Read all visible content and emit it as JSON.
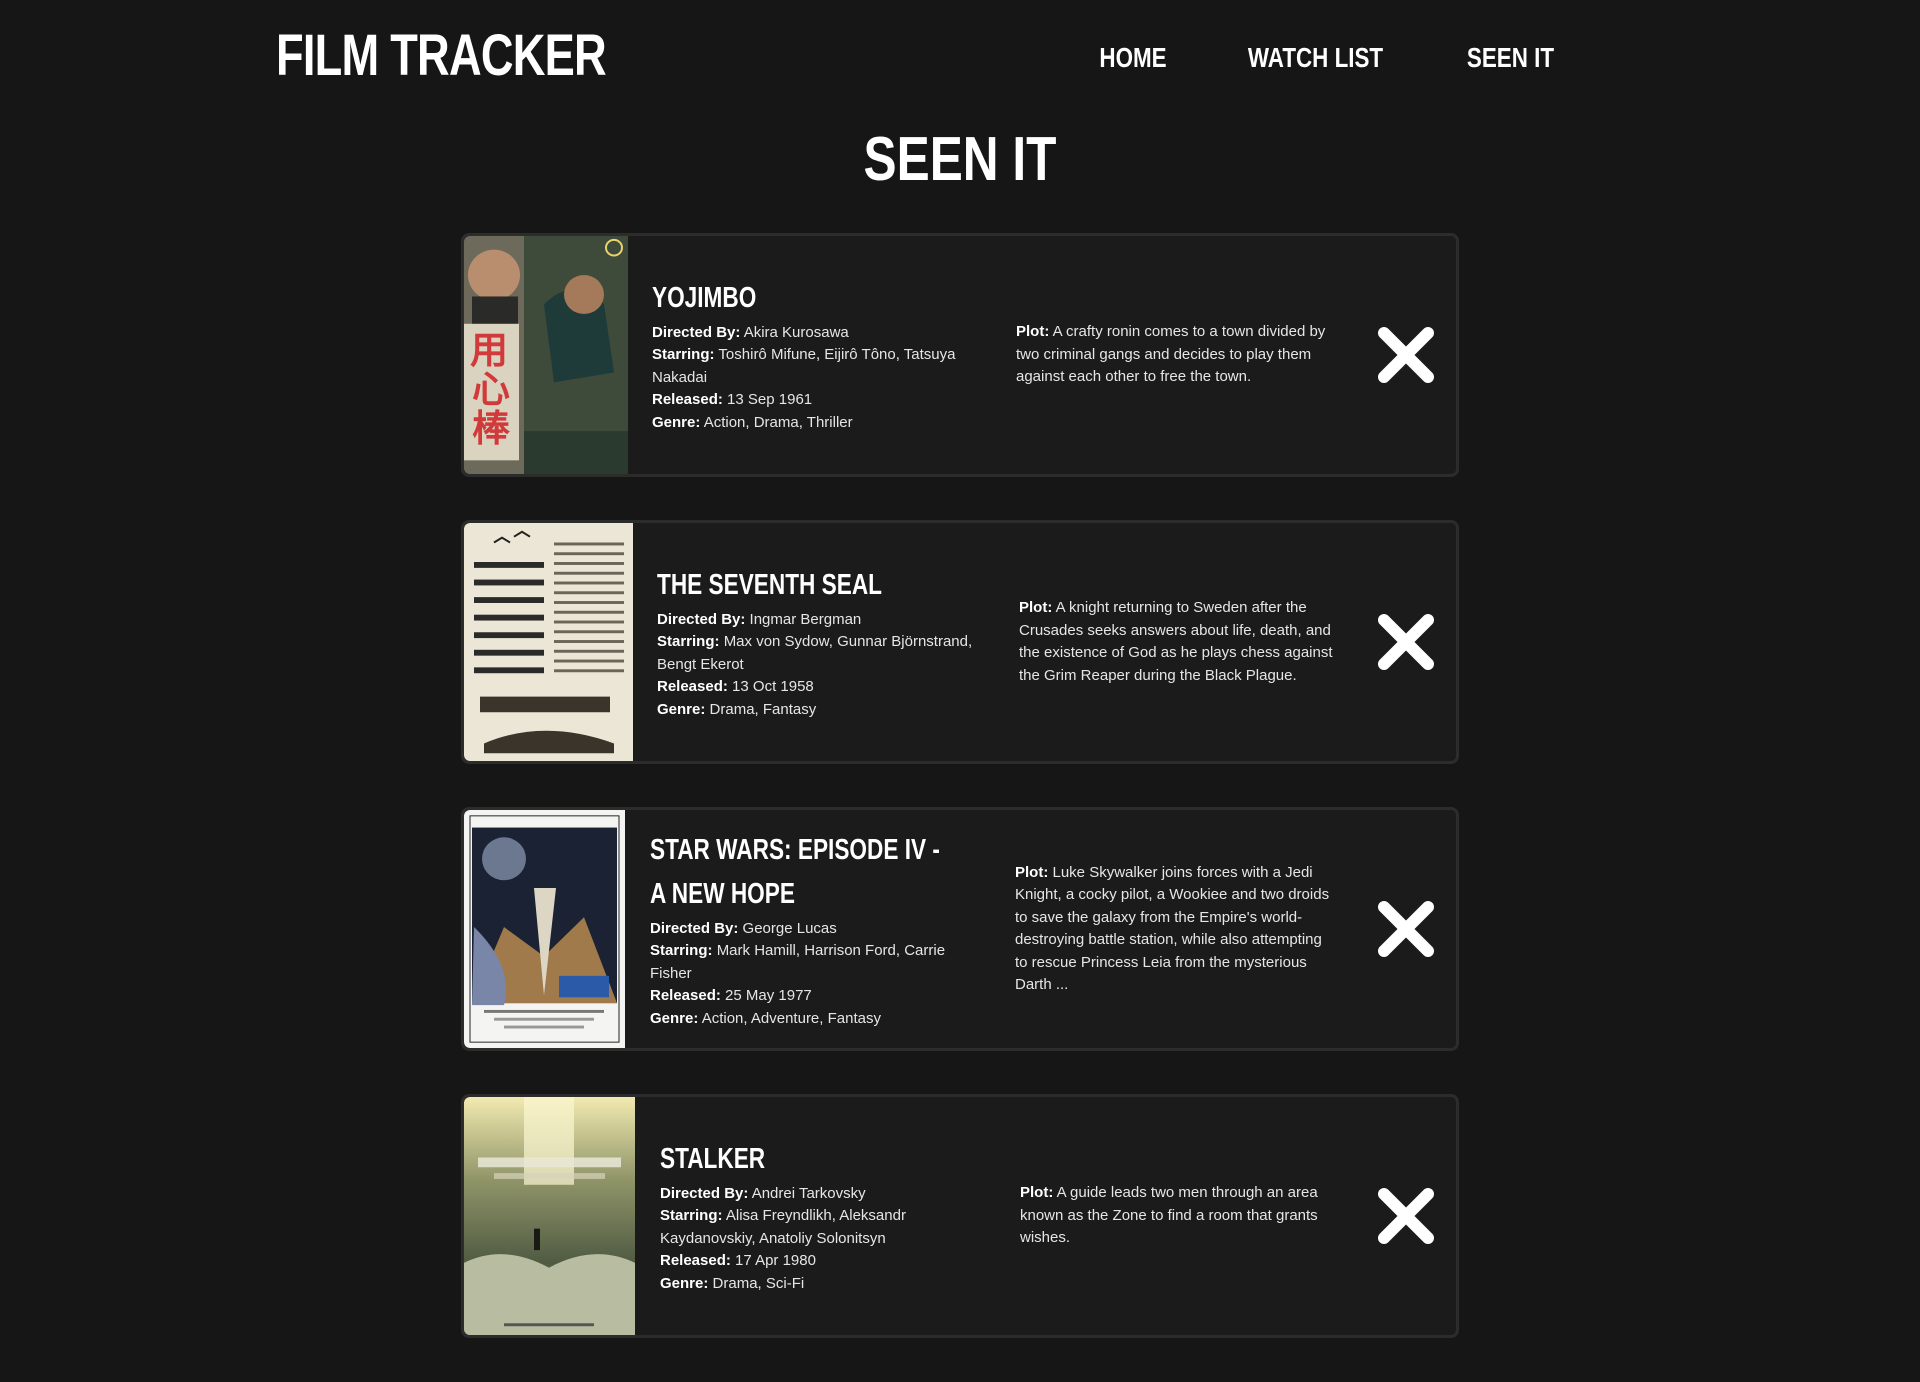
{
  "app": {
    "logo": "FILM TRACKER"
  },
  "nav": {
    "items": [
      {
        "label": "HOME"
      },
      {
        "label": "WATCH LIST"
      },
      {
        "label": "SEEN IT"
      }
    ]
  },
  "page": {
    "title": "SEEN IT"
  },
  "labels": {
    "directed_by": "Directed By:",
    "starring": "Starring:",
    "released": "Released:",
    "genre": "Genre:",
    "plot": "Plot:"
  },
  "movies": [
    {
      "title": "YOJIMBO",
      "directed_by": "Akira Kurosawa",
      "starring": "Toshirô Mifune, Eijirô Tôno, Tatsuya Nakadai",
      "released": "13 Sep 1961",
      "genre": "Action, Drama, Thriller",
      "plot": "A crafty ronin comes to a town divided by two criminal gangs and decides to play them against each other to free the town."
    },
    {
      "title": "THE SEVENTH SEAL",
      "directed_by": "Ingmar Bergman",
      "starring": "Max von Sydow, Gunnar Björnstrand, Bengt Ekerot",
      "released": "13 Oct 1958",
      "genre": "Drama, Fantasy",
      "plot": "A knight returning to Sweden after the Crusades seeks answers about life, death, and the existence of God as he plays chess against the Grim Reaper during the Black Plague."
    },
    {
      "title": "STAR WARS: EPISODE IV - A NEW HOPE",
      "directed_by": "George Lucas",
      "starring": "Mark Hamill, Harrison Ford, Carrie Fisher",
      "released": "25 May 1977",
      "genre": "Action, Adventure, Fantasy",
      "plot": "Luke Skywalker joins forces with a Jedi Knight, a cocky pilot, a Wookiee and two droids to save the galaxy from the Empire's world-destroying battle station, while also attempting to rescue Princess Leia from the mysterious Darth ..."
    },
    {
      "title": "STALKER",
      "directed_by": "Andrei Tarkovsky",
      "starring": "Alisa Freyndlikh, Aleksandr Kaydanovskiy, Anatoliy Solonitsyn",
      "released": "17 Apr 1980",
      "genre": "Drama, Sci-Fi",
      "plot": "A guide leads two men through an area known as the Zone to find a room that grants wishes."
    }
  ],
  "icons": {
    "remove": "close-icon"
  },
  "colors": {
    "background": "#161616",
    "card": "#1b1b1b",
    "card_border": "#2c2c2c",
    "text": "#ffffff"
  }
}
